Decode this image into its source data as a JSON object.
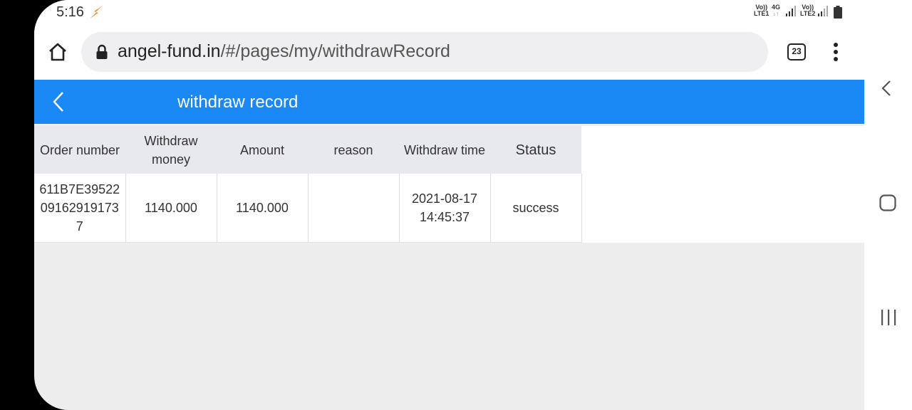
{
  "status_bar": {
    "time": "5:16",
    "sim1_top": "Vo))",
    "sim1_bottom": "LTE1",
    "net_top": "4G",
    "net_bottom": "↓↑",
    "sim2_top": "Vo))",
    "sim2_bottom": "LTE2"
  },
  "browser": {
    "url_host": "angel-fund.in",
    "url_path": "/#/pages/my/withdrawRecord",
    "tab_count": "23"
  },
  "app": {
    "title": "withdraw record"
  },
  "table": {
    "headers": [
      "Order number",
      "Withdraw money",
      "Amount",
      "reason",
      "Withdraw time",
      "Status"
    ],
    "rows": [
      {
        "order_number": "611B7E39522091629191737",
        "withdraw_money": "1140.000",
        "amount": "1140.000",
        "reason": "",
        "withdraw_time": "2021-08-17 14:45:37",
        "status": "success"
      }
    ]
  },
  "colors": {
    "accent": "#1a88f5",
    "status_icon": "#f08a24"
  }
}
